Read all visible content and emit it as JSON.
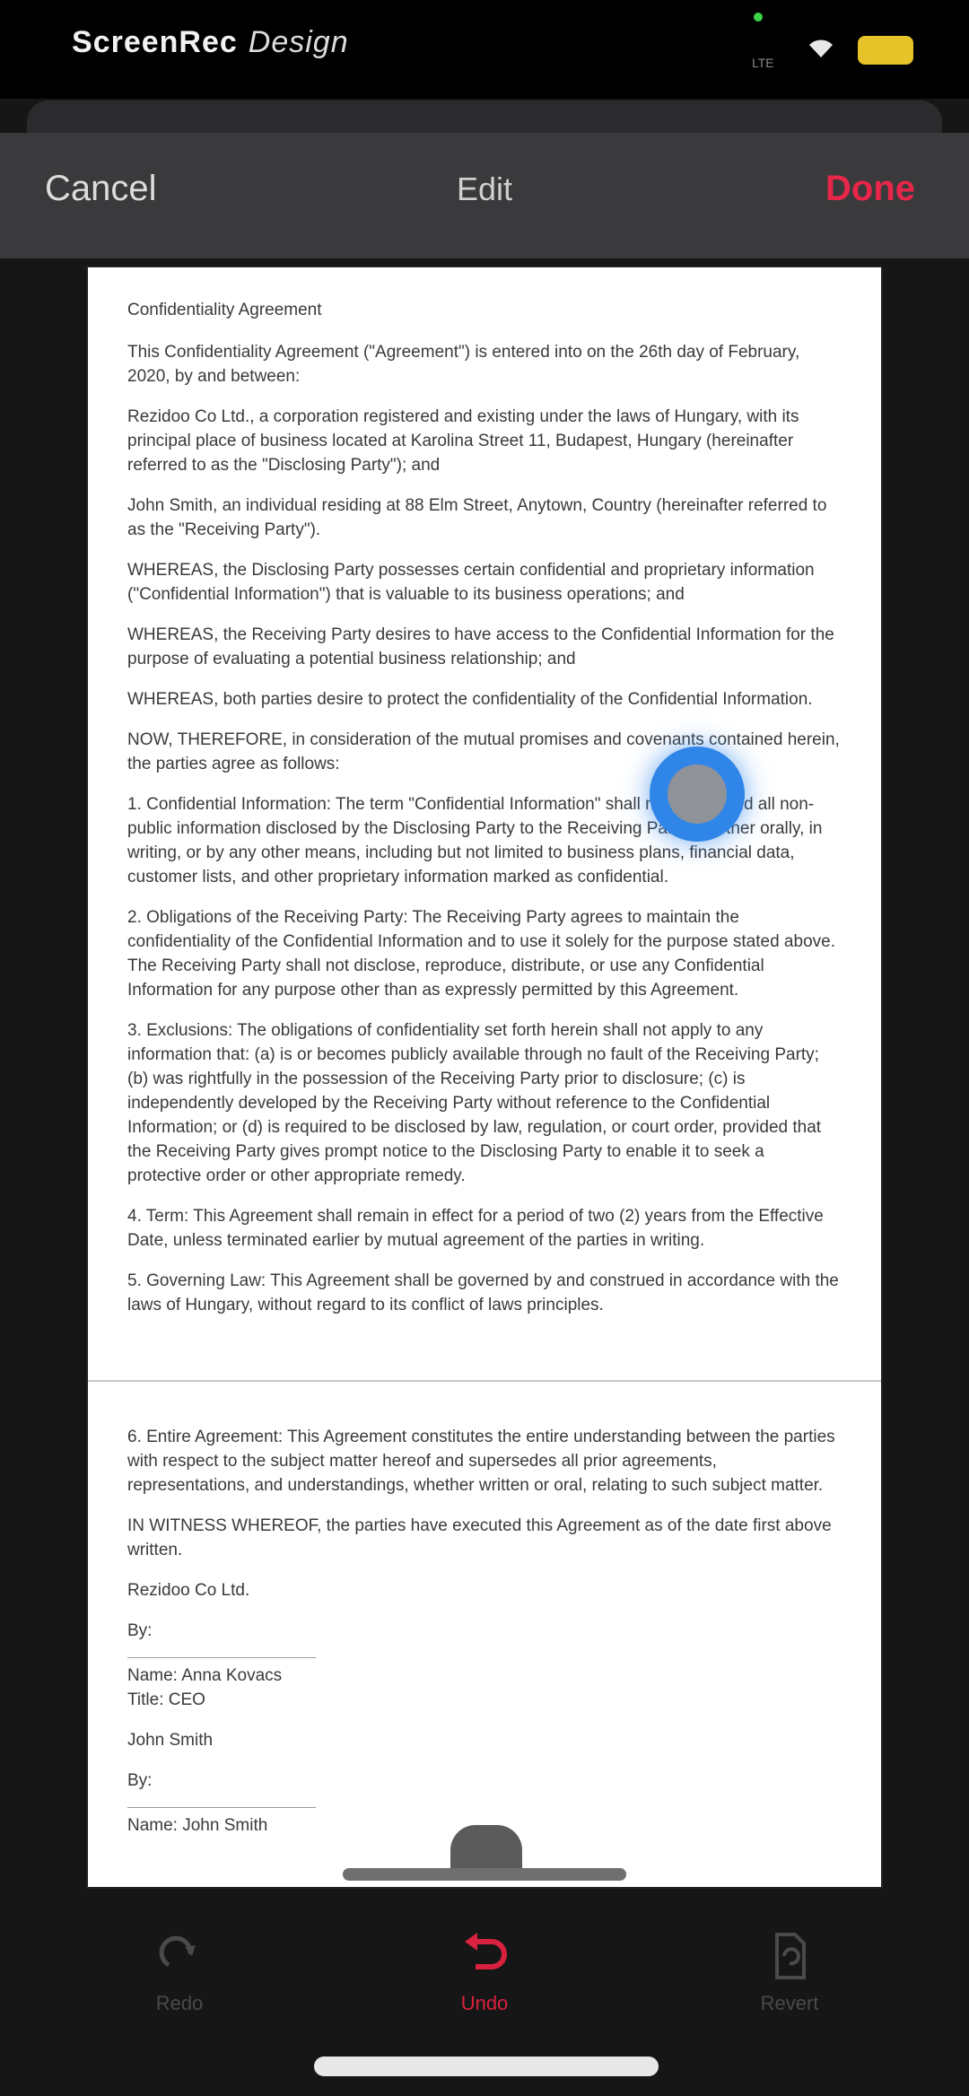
{
  "status_bar": {
    "app_title": "ScreenRec",
    "mode_label": "Design",
    "signal_text": "LTE"
  },
  "header": {
    "cancel_label": "Cancel",
    "title": "Edit",
    "done_label": "Done"
  },
  "document": {
    "title": "Confidentiality Agreement",
    "paragraphs": [
      "This Confidentiality Agreement (\"Agreement\") is entered into on the 26th day of February, 2020, by and between:",
      "Rezidoo Co Ltd., a corporation registered and existing under the laws of Hungary, with its principal place of business located at Karolina Street 11, Budapest, Hungary (hereinafter referred to as the \"Disclosing Party\"); and",
      "John Smith, an individual residing at 88 Elm Street, Anytown, Country (hereinafter referred to as the \"Receiving Party\").",
      "WHEREAS, the Disclosing Party possesses certain confidential and proprietary information (\"Confidential Information\") that is valuable to its business operations; and",
      "WHEREAS, the Receiving Party desires to have access to the Confidential Information for the purpose of evaluating a potential business relationship; and",
      "WHEREAS, both parties desire to protect the confidentiality of the Confidential Information.",
      "NOW, THEREFORE, in consideration of the mutual promises and covenants contained herein, the parties agree as follows:",
      "1. Confidential Information: The term \"Confidential Information\" shall mean any and all non-public information disclosed by the Disclosing Party to the Receiving Party, whether orally, in writing, or by any other means, including but not limited to business plans, financial data, customer lists, and other proprietary information marked as confidential.",
      "2. Obligations of the Receiving Party: The Receiving Party agrees to maintain the confidentiality of the Confidential Information and to use it solely for the purpose stated above. The Receiving Party shall not disclose, reproduce, distribute, or use any Confidential Information for any purpose other than as expressly permitted by this Agreement.",
      "3. Exclusions: The obligations of confidentiality set forth herein shall not apply to any information that: (a) is or becomes publicly available through no fault of the Receiving Party; (b) was rightfully in the possession of the Receiving Party prior to disclosure; (c) is independently developed by the Receiving Party without reference to the Confidential Information; or (d) is required to be disclosed by law, regulation, or court order, provided that the Receiving Party gives prompt notice to the Disclosing Party to enable it to seek a protective order or other appropriate remedy.",
      "4. Term: This Agreement shall remain in effect for a period of two (2) years from the Effective Date, unless terminated earlier by mutual agreement of the parties in writing.",
      "5. Governing Law: This Agreement shall be governed by and construed in accordance with the laws of Hungary, without regard to its conflict of laws principles."
    ],
    "closing_paragraphs": [
      "6. Entire Agreement: This Agreement constitutes the entire understanding between the parties with respect to the subject matter hereof and supersedes all prior agreements, representations, and understandings, whether written or oral, relating to such subject matter.",
      "IN WITNESS WHEREOF, the parties have executed this Agreement as of the date first above written."
    ],
    "party_one_name": "Rezidoo Co Ltd.",
    "party_one_by": "By:",
    "party_one_signatory": "Name: Anna Kovacs",
    "party_one_role": "Title: CEO",
    "party_two_name": "John Smith",
    "party_two_by": "By:",
    "party_two_signatory": "Name: John Smith"
  },
  "toolbar": {
    "items": [
      {
        "label": "Redo",
        "icon": "redo-icon",
        "state": "disabled"
      },
      {
        "label": "Undo",
        "icon": "undo-icon",
        "state": "active"
      },
      {
        "label": "Revert",
        "icon": "revert-icon",
        "state": "disabled"
      }
    ]
  },
  "colors": {
    "accent": "#e8264a",
    "background": "#161616",
    "header": "#3a3a3c"
  }
}
